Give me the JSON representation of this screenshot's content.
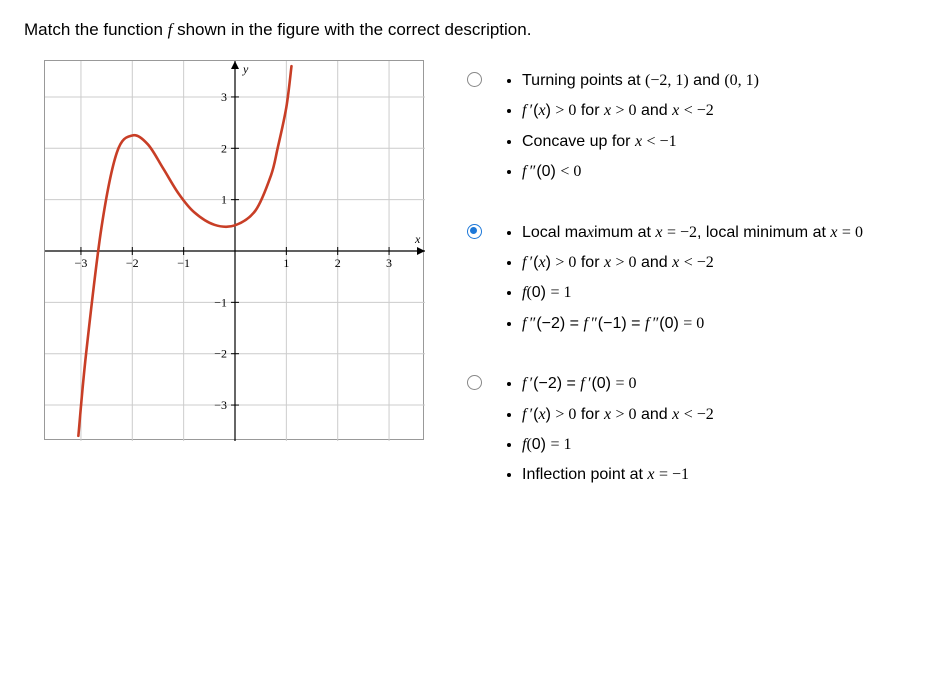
{
  "prompt": {
    "before": "Match the function ",
    "fn": "f",
    "after": " shown in the figure with the correct description."
  },
  "options": [
    {
      "checked": false,
      "items": [
        "Turning points at (−2, 1)  and (0, 1)",
        "f ′(x) > 0 for  x > 0 and x < −2",
        "Concave up for x < −1",
        "f ″(0) < 0"
      ]
    },
    {
      "checked": true,
      "items": [
        "Local maximum at x = −2, local minimum at x = 0",
        "f ′(x) > 0 for x > 0 and x < −2",
        "f(0) = 1",
        "f ″(−2) = f ″(−1) = f ″(0) = 0"
      ]
    },
    {
      "checked": false,
      "items": [
        "f ′(−2) = f ′(0) = 0",
        "f ′(x) > 0 for x > 0 and x < −2",
        "f(0) = 1",
        "Inflection point at x = −1"
      ]
    }
  ],
  "chart_data": {
    "type": "line",
    "title": "",
    "xlabel": "x",
    "ylabel": "y",
    "xlim": [
      -3.7,
      3.7
    ],
    "ylim": [
      -3.7,
      3.7
    ],
    "xticks": [
      -3,
      -2,
      -1,
      1,
      2,
      3
    ],
    "yticks": [
      -3,
      -2,
      -1,
      1,
      2,
      3
    ],
    "grid": true,
    "series": [
      {
        "name": "f(x)",
        "color": "#c83e26",
        "points": [
          [
            -3.05,
            -3.6
          ],
          [
            -2.9,
            -2.0
          ],
          [
            -2.6,
            0.46
          ],
          [
            -2.3,
            1.92
          ],
          [
            -2.0,
            2.25
          ],
          [
            -1.7,
            2.08
          ],
          [
            -1.4,
            1.61
          ],
          [
            -1.1,
            1.12
          ],
          [
            -0.8,
            0.76
          ],
          [
            -0.4,
            0.51
          ],
          [
            0.0,
            0.5
          ],
          [
            0.4,
            0.79
          ],
          [
            0.7,
            1.47
          ],
          [
            0.83,
            2.0
          ],
          [
            1.0,
            2.8
          ],
          [
            1.1,
            3.6
          ]
        ]
      }
    ]
  }
}
